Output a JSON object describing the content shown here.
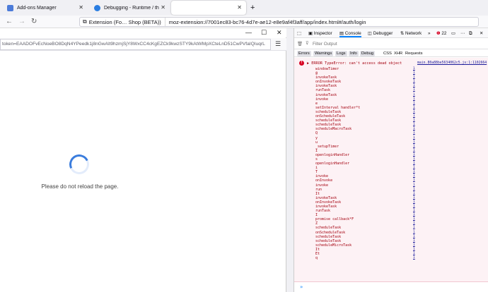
{
  "tabs": [
    {
      "title": "Add-ons Manager",
      "icon_color": "#4c7bd9"
    },
    {
      "title": "Debugging - Runtime / this-fire",
      "icon_color": "#2a7de1"
    },
    {
      "title": "",
      "icon_color": "#ffffff"
    }
  ],
  "new_tab_symbol": "+",
  "window_controls": {
    "minimize": "—",
    "maximize": "☐",
    "close": "✕"
  },
  "url_bar": {
    "extension_chip": "Extension (Fo… Shop (BETA))",
    "url": "moz-extension://7001ec83-bc76-4d7e-ae12-e8e9af4f3aff/app/index.html#/auth/login"
  },
  "popup": {
    "url": "token=EAADOFvEcNoeBO8DqN4YPeedk1j8nGwAlt9hzmjSjY8WxCC4cKgEZCk9kwzSTY9kAtWMpXCteLnD51CwPVfaIQIuqrL",
    "message": "Please do not reload the page."
  },
  "devtools": {
    "tabs": [
      "Inspector",
      "Console",
      "Debugger",
      "Network"
    ],
    "selected_tab": "Console",
    "error_count": "22",
    "filter_placeholder": "Filter Output",
    "categories": [
      "Errors",
      "Warnings",
      "Logs",
      "Info",
      "Debug",
      "CSS",
      "XHR",
      "Requests"
    ],
    "error": {
      "message": "▶ ERROR TypeError: can't access dead object",
      "source": "main.80a88be5634062c5.js:1:1102664",
      "frames": [
        "windowTimer",
        "@",
        "invokeTask",
        "onInvokeTask",
        "invokeTask",
        "runTask",
        "invokeTask",
        "invoke",
        "e",
        "setInterval handler*t",
        "scheduleTask",
        "onScheduleTask",
        "scheduleTask",
        "scheduleTask",
        "scheduleMacroTask",
        "Q",
        "y",
        "u",
        "_setupTimer",
        "I",
        "openloginHandler",
        "s",
        "openloginHandler",
        "i",
        "T",
        "invoke",
        "onInvoke",
        "invoke",
        "run",
        "It",
        "invokeTask",
        "onInvokeTask",
        "invokeTask",
        "runTask",
        "I",
        "promise callback*F",
        "Z",
        "scheduleTask",
        "onScheduleTask",
        "scheduleTask",
        "scheduleTask",
        "scheduleMicroTask",
        "It",
        "Et",
        "q"
      ],
      "frame_source": "1"
    },
    "prompt": "»"
  }
}
